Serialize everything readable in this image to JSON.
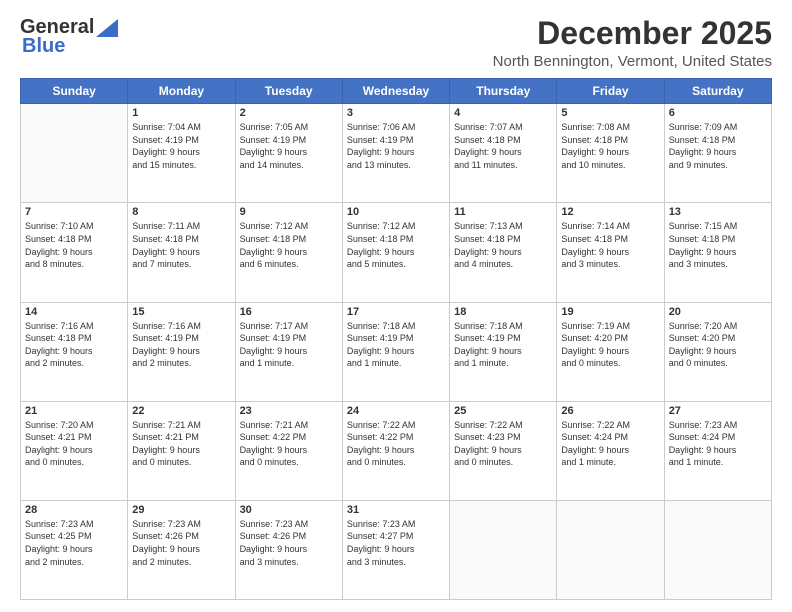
{
  "logo": {
    "general": "General",
    "blue": "Blue"
  },
  "title": "December 2025",
  "location": "North Bennington, Vermont, United States",
  "weekdays": [
    "Sunday",
    "Monday",
    "Tuesday",
    "Wednesday",
    "Thursday",
    "Friday",
    "Saturday"
  ],
  "weeks": [
    [
      {
        "day": "",
        "info": ""
      },
      {
        "day": "1",
        "info": "Sunrise: 7:04 AM\nSunset: 4:19 PM\nDaylight: 9 hours\nand 15 minutes."
      },
      {
        "day": "2",
        "info": "Sunrise: 7:05 AM\nSunset: 4:19 PM\nDaylight: 9 hours\nand 14 minutes."
      },
      {
        "day": "3",
        "info": "Sunrise: 7:06 AM\nSunset: 4:19 PM\nDaylight: 9 hours\nand 13 minutes."
      },
      {
        "day": "4",
        "info": "Sunrise: 7:07 AM\nSunset: 4:18 PM\nDaylight: 9 hours\nand 11 minutes."
      },
      {
        "day": "5",
        "info": "Sunrise: 7:08 AM\nSunset: 4:18 PM\nDaylight: 9 hours\nand 10 minutes."
      },
      {
        "day": "6",
        "info": "Sunrise: 7:09 AM\nSunset: 4:18 PM\nDaylight: 9 hours\nand 9 minutes."
      }
    ],
    [
      {
        "day": "7",
        "info": "Sunrise: 7:10 AM\nSunset: 4:18 PM\nDaylight: 9 hours\nand 8 minutes."
      },
      {
        "day": "8",
        "info": "Sunrise: 7:11 AM\nSunset: 4:18 PM\nDaylight: 9 hours\nand 7 minutes."
      },
      {
        "day": "9",
        "info": "Sunrise: 7:12 AM\nSunset: 4:18 PM\nDaylight: 9 hours\nand 6 minutes."
      },
      {
        "day": "10",
        "info": "Sunrise: 7:12 AM\nSunset: 4:18 PM\nDaylight: 9 hours\nand 5 minutes."
      },
      {
        "day": "11",
        "info": "Sunrise: 7:13 AM\nSunset: 4:18 PM\nDaylight: 9 hours\nand 4 minutes."
      },
      {
        "day": "12",
        "info": "Sunrise: 7:14 AM\nSunset: 4:18 PM\nDaylight: 9 hours\nand 3 minutes."
      },
      {
        "day": "13",
        "info": "Sunrise: 7:15 AM\nSunset: 4:18 PM\nDaylight: 9 hours\nand 3 minutes."
      }
    ],
    [
      {
        "day": "14",
        "info": "Sunrise: 7:16 AM\nSunset: 4:18 PM\nDaylight: 9 hours\nand 2 minutes."
      },
      {
        "day": "15",
        "info": "Sunrise: 7:16 AM\nSunset: 4:19 PM\nDaylight: 9 hours\nand 2 minutes."
      },
      {
        "day": "16",
        "info": "Sunrise: 7:17 AM\nSunset: 4:19 PM\nDaylight: 9 hours\nand 1 minute."
      },
      {
        "day": "17",
        "info": "Sunrise: 7:18 AM\nSunset: 4:19 PM\nDaylight: 9 hours\nand 1 minute."
      },
      {
        "day": "18",
        "info": "Sunrise: 7:18 AM\nSunset: 4:19 PM\nDaylight: 9 hours\nand 1 minute."
      },
      {
        "day": "19",
        "info": "Sunrise: 7:19 AM\nSunset: 4:20 PM\nDaylight: 9 hours\nand 0 minutes."
      },
      {
        "day": "20",
        "info": "Sunrise: 7:20 AM\nSunset: 4:20 PM\nDaylight: 9 hours\nand 0 minutes."
      }
    ],
    [
      {
        "day": "21",
        "info": "Sunrise: 7:20 AM\nSunset: 4:21 PM\nDaylight: 9 hours\nand 0 minutes."
      },
      {
        "day": "22",
        "info": "Sunrise: 7:21 AM\nSunset: 4:21 PM\nDaylight: 9 hours\nand 0 minutes."
      },
      {
        "day": "23",
        "info": "Sunrise: 7:21 AM\nSunset: 4:22 PM\nDaylight: 9 hours\nand 0 minutes."
      },
      {
        "day": "24",
        "info": "Sunrise: 7:22 AM\nSunset: 4:22 PM\nDaylight: 9 hours\nand 0 minutes."
      },
      {
        "day": "25",
        "info": "Sunrise: 7:22 AM\nSunset: 4:23 PM\nDaylight: 9 hours\nand 0 minutes."
      },
      {
        "day": "26",
        "info": "Sunrise: 7:22 AM\nSunset: 4:24 PM\nDaylight: 9 hours\nand 1 minute."
      },
      {
        "day": "27",
        "info": "Sunrise: 7:23 AM\nSunset: 4:24 PM\nDaylight: 9 hours\nand 1 minute."
      }
    ],
    [
      {
        "day": "28",
        "info": "Sunrise: 7:23 AM\nSunset: 4:25 PM\nDaylight: 9 hours\nand 2 minutes."
      },
      {
        "day": "29",
        "info": "Sunrise: 7:23 AM\nSunset: 4:26 PM\nDaylight: 9 hours\nand 2 minutes."
      },
      {
        "day": "30",
        "info": "Sunrise: 7:23 AM\nSunset: 4:26 PM\nDaylight: 9 hours\nand 3 minutes."
      },
      {
        "day": "31",
        "info": "Sunrise: 7:23 AM\nSunset: 4:27 PM\nDaylight: 9 hours\nand 3 minutes."
      },
      {
        "day": "",
        "info": ""
      },
      {
        "day": "",
        "info": ""
      },
      {
        "day": "",
        "info": ""
      }
    ]
  ]
}
